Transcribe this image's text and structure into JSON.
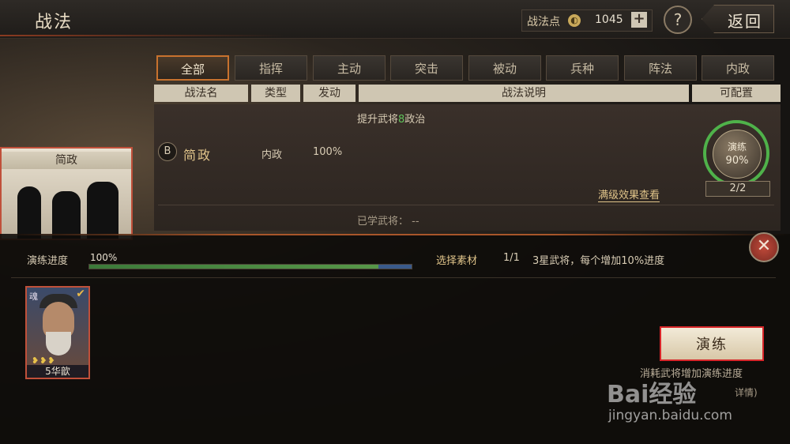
{
  "header": {
    "title": "战法",
    "points_label": "战法点",
    "points_coin": "◐",
    "points_value": "1045",
    "plus": "+",
    "help": "?",
    "back": "返回"
  },
  "tabs": [
    "全部",
    "指挥",
    "主动",
    "突击",
    "被动",
    "兵种",
    "阵法",
    "内政"
  ],
  "active_tab": 0,
  "columns": [
    "战法名",
    "类型",
    "发动",
    "战法说明",
    "可配置"
  ],
  "skill": {
    "grade": "B",
    "name": "简政",
    "type": "内政",
    "rate": "100%",
    "desc_prefix": "提升武将",
    "desc_num": "8",
    "desc_suffix": "政治",
    "ring_label": "演练",
    "ring_percent": "90%",
    "ring_progress": 0.9,
    "count": "2/2",
    "full_effect": "满级效果查看",
    "learned": "已学武将：  --"
  },
  "skill_card": {
    "title": "简政"
  },
  "progress": {
    "label": "演练进度",
    "value_text": "100%",
    "value": 1.0
  },
  "selection": {
    "label": "选择素材",
    "count": "1/1",
    "note": "3星武将，每个增加10%进度"
  },
  "general": {
    "badge": "魂",
    "stars": "❥❥❥",
    "name": "5华歆"
  },
  "train_button": "演练",
  "tip": "消耗武将增加演练进度",
  "tip2": "详情)",
  "watermark": {
    "brand": "Bai经验",
    "url": "jingyan.baidu.com"
  },
  "close": "✕",
  "colors": {
    "accent": "#c8722e",
    "ring": "#4fb24a",
    "highlight": "#d8262a",
    "gold": "#e0c48a"
  }
}
